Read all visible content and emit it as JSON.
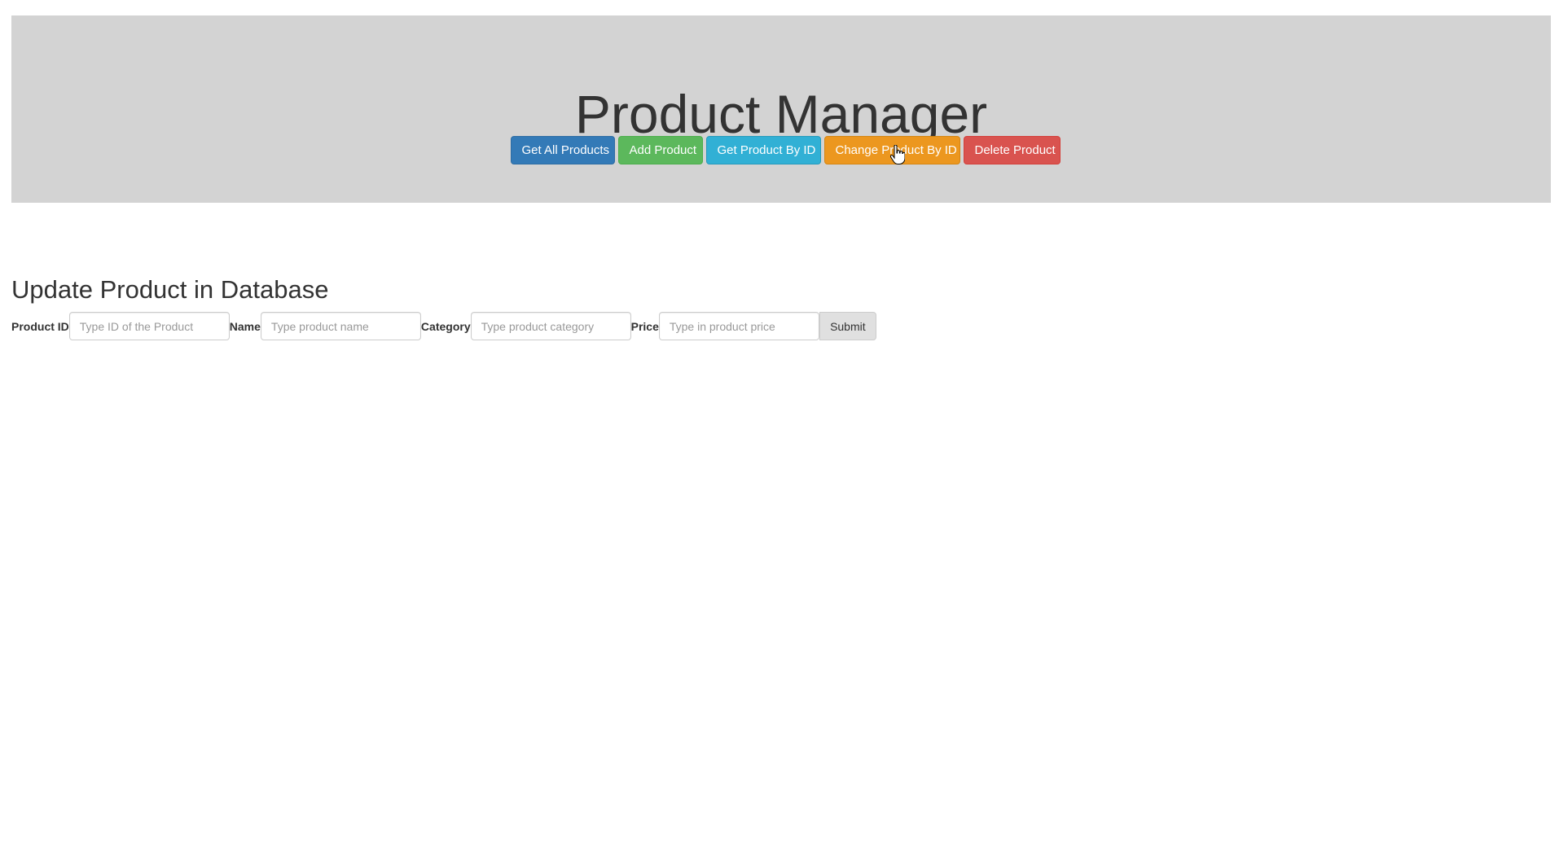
{
  "header": {
    "title": "Product Manager",
    "buttons": [
      {
        "label": "Get All Products",
        "color": "#337ab7"
      },
      {
        "label": "Add Product",
        "color": "#5cb85c"
      },
      {
        "label": "Get Product By ID",
        "color": "#31b0d5"
      },
      {
        "label": "Change Product By ID",
        "color": "#ec971f"
      },
      {
        "label": "Delete Product",
        "color": "#d9534f"
      }
    ],
    "background": "#d3d3d3"
  },
  "form": {
    "title": "Update Product in Database",
    "fields": [
      {
        "label": "Product ID",
        "placeholder": "Type ID of the Product",
        "value": ""
      },
      {
        "label": "Name",
        "placeholder": "Type product name",
        "value": ""
      },
      {
        "label": "Category",
        "placeholder": "Type product category",
        "value": ""
      },
      {
        "label": "Price",
        "placeholder": "Type in product price",
        "value": ""
      }
    ],
    "submit_label": "Submit"
  },
  "cursor": {
    "icon": "hand-pointer-icon"
  }
}
